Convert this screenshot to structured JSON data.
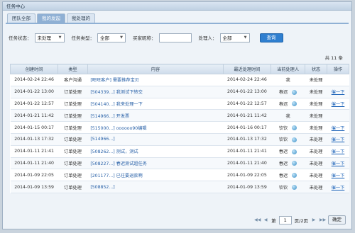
{
  "window": {
    "title": "任务中心"
  },
  "tabs": [
    {
      "label": "团队全部"
    },
    {
      "label": "我的发起"
    },
    {
      "label": "我处理的"
    }
  ],
  "filters": {
    "status_label": "任务状态：",
    "status_value": "未处理",
    "type_label": "任务类型：",
    "type_value": "全部",
    "buyer_label": "买家昵称：",
    "buyer_value": "",
    "handler_label": "处理人：",
    "handler_value": "全部",
    "query_label": "查询"
  },
  "total_text": "共 11 条",
  "table": {
    "headers": [
      "创建时间",
      "类型",
      "内容",
      "最近处理时间",
      "当前处理人",
      "状态",
      "操作"
    ],
    "rows": [
      {
        "created": "2014-02-24 22:46",
        "type": "客户沟通",
        "content": "[旺旺客户] 需要推荐宝贝",
        "updated": "2014-02-24 22:46",
        "handler": "我",
        "icon": false,
        "status": "未处理",
        "action": ""
      },
      {
        "created": "2014-01-22 13:00",
        "type": "订单处理",
        "content": "[504339...] 我测试下转交",
        "updated": "2014-01-22 13:00",
        "handler": "春迟",
        "icon": true,
        "status": "未处理",
        "action": "催一下"
      },
      {
        "created": "2014-01-22 12:57",
        "type": "订单处理",
        "content": "[504140...] 我来处理一下",
        "updated": "2014-01-22 12:57",
        "handler": "春迟",
        "icon": true,
        "status": "未处理",
        "action": "催一下"
      },
      {
        "created": "2014-01-21 11:42",
        "type": "订单处理",
        "content": "[514966...] 开发票",
        "updated": "2014-01-21 11:42",
        "handler": "我",
        "icon": false,
        "status": "未处理",
        "action": ""
      },
      {
        "created": "2014-01-15 00:17",
        "type": "订单处理",
        "content": "[515000...] oooooo90编辑",
        "updated": "2014-01-16 00:17",
        "handler": "钦钦",
        "icon": true,
        "status": "未处理",
        "action": "催一下"
      },
      {
        "created": "2014-01-13 17:32",
        "type": "订单处理",
        "content": "[514966...]",
        "updated": "2014-01-13 17:32",
        "handler": "钦钦",
        "icon": true,
        "status": "未处理",
        "action": "催一下"
      },
      {
        "created": "2014-01-11 21:41",
        "type": "订单处理",
        "content": "[508262...] 测试，测试",
        "updated": "2014-01-11 21:41",
        "handler": "春迟",
        "icon": true,
        "status": "未处理",
        "action": "催一下"
      },
      {
        "created": "2014-01-11 21:40",
        "type": "订单处理",
        "content": "[508227...] 春迟测试超任务",
        "updated": "2014-01-11 21:40",
        "handler": "春迟",
        "icon": true,
        "status": "未处理",
        "action": "催一下"
      },
      {
        "created": "2014-01-09 22:05",
        "type": "订单处理",
        "content": "[201177...] 已往要退款啊",
        "updated": "2014-01-09 22:05",
        "handler": "春迟",
        "icon": true,
        "status": "未处理",
        "action": "催一下"
      },
      {
        "created": "2014-01-09 13:59",
        "type": "订单处理",
        "content": "[508852...]",
        "updated": "2014-01-09 13:59",
        "handler": "钦钦",
        "icon": true,
        "status": "未处理",
        "action": "催一下"
      }
    ]
  },
  "pager": {
    "first": "◀◀",
    "prev": "◀",
    "page_prefix": "第",
    "page_value": "1",
    "page_suffix": "页/2页",
    "next": "▶",
    "last": "▶▶",
    "confirm": "确定"
  }
}
